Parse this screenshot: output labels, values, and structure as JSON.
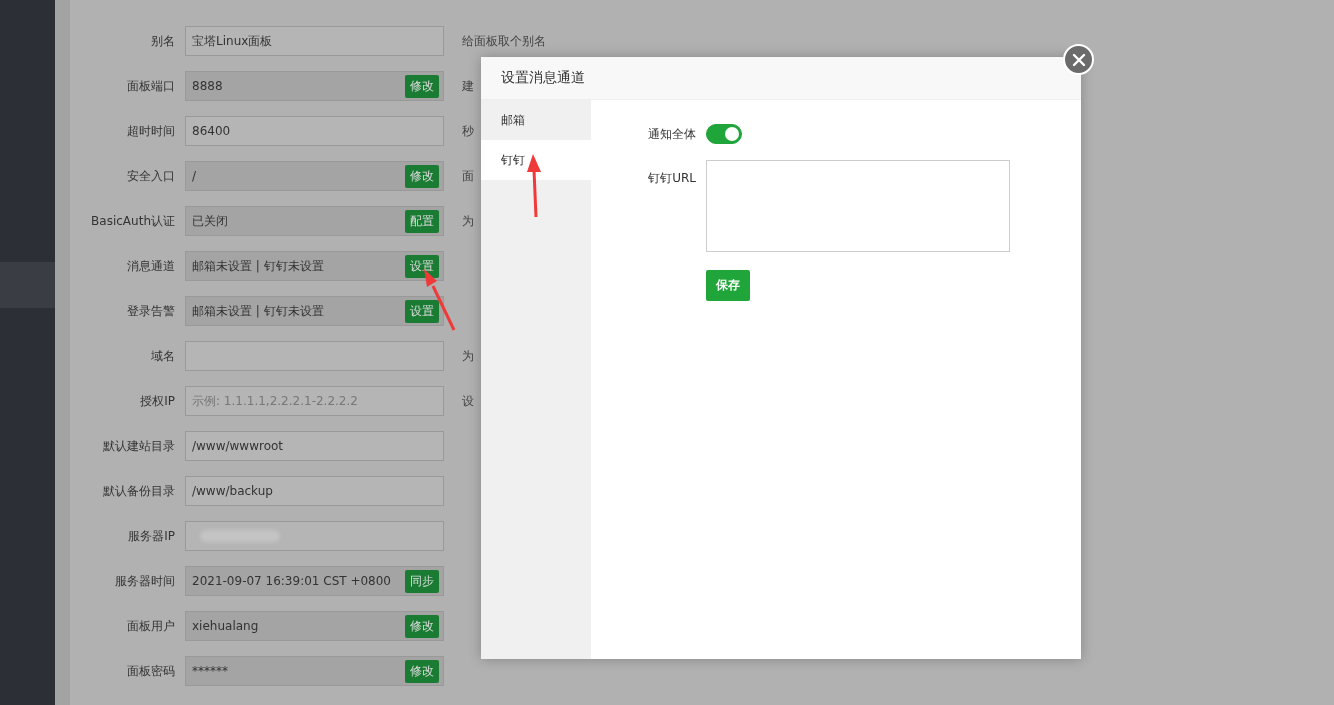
{
  "sidebar": {
    "items": [
      {
        "selected": true
      }
    ]
  },
  "settings": [
    {
      "label": "别名",
      "value": "宝塔Linux面板",
      "readonly": false,
      "hint": "给面板取个别名"
    },
    {
      "label": "面板端口",
      "value": "8888",
      "readonly": true,
      "button": "修改",
      "hint": "建"
    },
    {
      "label": "超时时间",
      "value": "86400",
      "readonly": false,
      "hint": "秒"
    },
    {
      "label": "安全入口",
      "value": "/",
      "readonly": true,
      "button": "修改",
      "hint": "面"
    },
    {
      "label": "BasicAuth认证",
      "value": "已关闭",
      "readonly": true,
      "button": "配置",
      "hint": "为"
    },
    {
      "label": "消息通道",
      "value": "邮箱未设置 | 钉钉未设置",
      "readonly": true,
      "button": "设置"
    },
    {
      "label": "登录告警",
      "value": "邮箱未设置 | 钉钉未设置",
      "readonly": true,
      "button": "设置"
    },
    {
      "label": "域名",
      "readonly": false,
      "hint": "为"
    },
    {
      "label": "授权IP",
      "placeholder": "示例: 1.1.1.1,2.2.2.1-2.2.2.2",
      "readonly": false,
      "hint": "设"
    },
    {
      "label": "默认建站目录",
      "value": "/www/wwwroot",
      "readonly": false
    },
    {
      "label": "默认备份目录",
      "value": "/www/backup",
      "readonly": false
    },
    {
      "label": "服务器IP",
      "redacted": true,
      "readonly": false
    },
    {
      "label": "服务器时间",
      "value": "2021-09-07 16:39:01 CST +0800",
      "readonly": true,
      "button": "同步"
    },
    {
      "label": "面板用户",
      "value": "xiehualang",
      "readonly": true,
      "button": "修改"
    },
    {
      "label": "面板密码",
      "value": "******",
      "readonly": true,
      "button": "修改"
    }
  ],
  "dialog": {
    "title": "设置消息通道",
    "tabs": [
      {
        "label": "邮箱",
        "selected": false
      },
      {
        "label": "钉钉",
        "selected": true
      }
    ],
    "notify_all": {
      "label": "通知全体",
      "on": true
    },
    "url": {
      "label": "钉钉URL"
    },
    "save": "保存"
  }
}
